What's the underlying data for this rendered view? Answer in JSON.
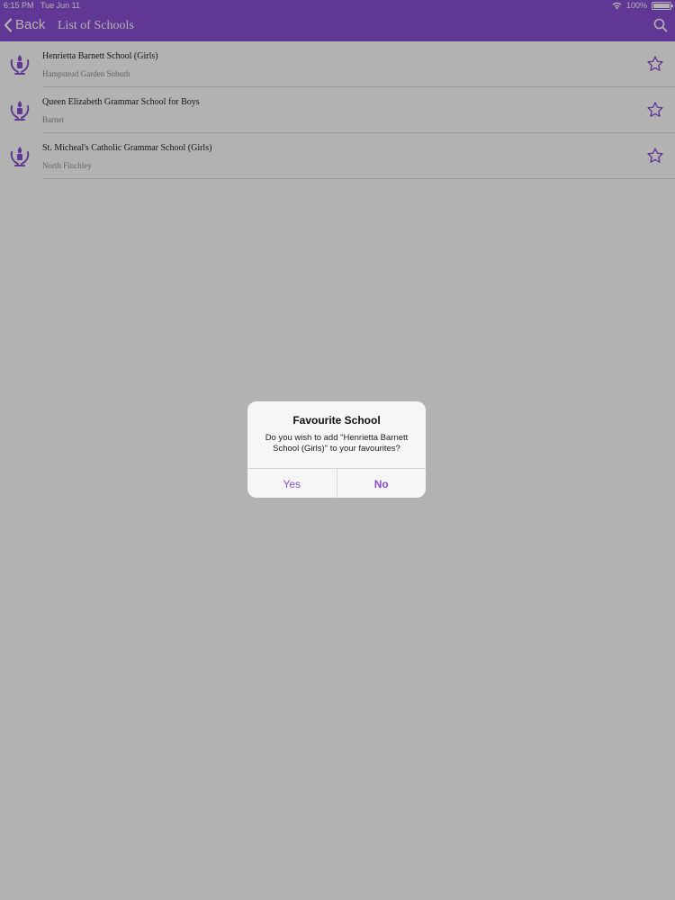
{
  "status_bar": {
    "time": "6:15 PM",
    "date": "Tue Jun 11",
    "battery": "100%"
  },
  "nav": {
    "back_label": "Back",
    "title": "List of Schools"
  },
  "schools": [
    {
      "name": "Henrietta Barnett School (Girls)",
      "area": "Hampstead Garden Suburb"
    },
    {
      "name": "Queen Elizabeth Grammar School for Boys",
      "area": "Barnet"
    },
    {
      "name": "St. Micheal's Catholic Grammar School (Girls)",
      "area": "North Finchley"
    }
  ],
  "alert": {
    "title": "Favourite School",
    "message": "Do you wish to add \"Henrietta Barnett School (Girls)\" to your favourites?",
    "yes_label": "Yes",
    "no_label": "No"
  },
  "icons": {
    "back": "chevron-left-icon",
    "search": "search-icon",
    "wifi": "wifi-icon",
    "battery": "battery-icon",
    "school_logo": "school-crest-icon",
    "favourite": "star-outline-icon"
  },
  "colors": {
    "accent": "#8a4fd4",
    "overlay": "rgba(0,0,0,0.30)"
  }
}
